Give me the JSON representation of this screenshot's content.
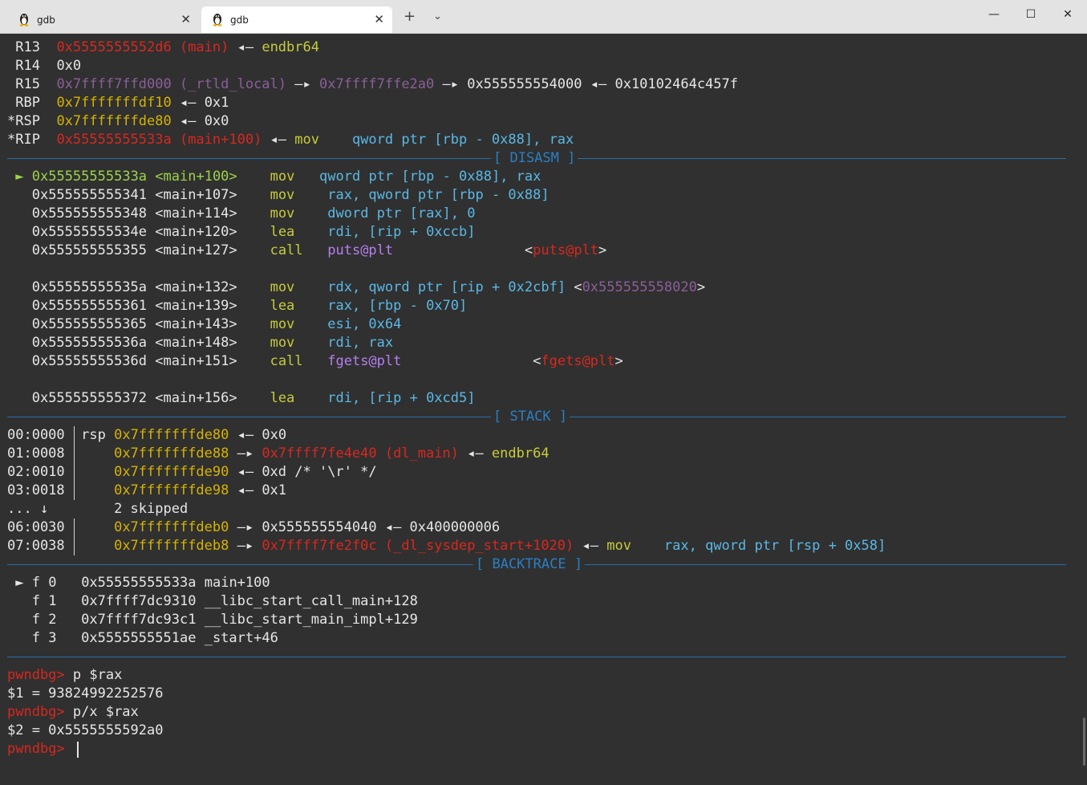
{
  "window": {
    "tabs": [
      {
        "label": "gdb",
        "icon": "linux-penguin-icon",
        "active": false
      },
      {
        "label": "gdb",
        "icon": "linux-penguin-icon",
        "active": true
      }
    ],
    "new_tab": "+",
    "dropdown": "⌄",
    "minimize": "—",
    "maximize": "☐",
    "close": "✕",
    "tab_close": "✕"
  },
  "registers": [
    {
      "name": " R13",
      "val": "0x5555555552d6 (main)",
      "arrow": " ◂— ",
      "target": "endbr64"
    },
    {
      "name": " R14",
      "val": "0x0"
    },
    {
      "name": " R15",
      "val": "0x7ffff7ffd000 (_rtld_local)",
      "arrow1": " —▸ ",
      "val2": "0x7ffff7ffe2a0",
      "arrow2": " —▸ ",
      "val3": "0x555555554000",
      "arrow3": " ◂— ",
      "val4": "0x10102464c457f"
    },
    {
      "name": " RBP",
      "val": "0x7fffffffdf10",
      "arrow": " ◂— ",
      "target": "0x1"
    },
    {
      "name": "*RSP",
      "val": "0x7fffffffde80",
      "arrow": " ◂— ",
      "target": "0x0"
    },
    {
      "name": "*RIP",
      "val": "0x55555555533a (main+100)",
      "arrow": " ◂— ",
      "mnem": "mov",
      "ops": "qword ptr [rbp - 0x88], rax"
    }
  ],
  "sections": {
    "disasm": "[ DISASM ]",
    "stack": "[ STACK ]",
    "backtrace": "[ BACKTRACE ]"
  },
  "disasm": [
    {
      "marker": "►",
      "addr": "0x55555555533a",
      "sym": "<main+100>",
      "mnem": "mov",
      "ops": "qword ptr [rbp - 0x88], rax"
    },
    {
      "marker": " ",
      "addr": "0x555555555341",
      "sym": "<main+107>",
      "mnem": "mov",
      "ops": "rax, qword ptr [rbp - 0x88]"
    },
    {
      "marker": " ",
      "addr": "0x555555555348",
      "sym": "<main+114>",
      "mnem": "mov",
      "ops": "dword ptr [rax], 0"
    },
    {
      "marker": " ",
      "addr": "0x55555555534e",
      "sym": "<main+120>",
      "mnem": "lea",
      "ops": "rdi, [rip + 0xccb]"
    },
    {
      "marker": " ",
      "addr": "0x555555555355",
      "sym": "<main+127>",
      "mnem": "call",
      "ops": "puts@plt",
      "target": "puts@plt"
    },
    {
      "marker": " ",
      "addr": "0x55555555535a",
      "sym": "<main+132>",
      "mnem": "mov",
      "ops": "rdx, qword ptr [rip + 0x2cbf]",
      "target": "0x555555558020"
    },
    {
      "marker": " ",
      "addr": "0x555555555361",
      "sym": "<main+139>",
      "mnem": "lea",
      "ops": "rax, [rbp - 0x70]"
    },
    {
      "marker": " ",
      "addr": "0x555555555365",
      "sym": "<main+143>",
      "mnem": "mov",
      "ops": "esi, 0x64"
    },
    {
      "marker": " ",
      "addr": "0x55555555536a",
      "sym": "<main+148>",
      "mnem": "mov",
      "ops": "rdi, rax"
    },
    {
      "marker": " ",
      "addr": "0x55555555536d",
      "sym": "<main+151>",
      "mnem": "call",
      "ops": "fgets@plt",
      "target": "fgets@plt"
    },
    {
      "marker": " ",
      "addr": "0x555555555372",
      "sym": "<main+156>",
      "mnem": "lea",
      "ops": "rdi, [rip + 0xcd5]"
    }
  ],
  "stack": [
    {
      "off": "00:0000",
      "reg": "rsp",
      "addr": "0x7fffffffde80",
      "rest": " ◂— 0x0"
    },
    {
      "off": "01:0008",
      "reg": "",
      "addr": "0x7fffffffde88",
      "arrow": " —▸ ",
      "val": "0x7ffff7fe4e40 (dl_main)",
      "rest": " ◂— endbr64"
    },
    {
      "off": "02:0010",
      "reg": "",
      "addr": "0x7fffffffde90",
      "rest": " ◂— 0xd /* '\\r' */"
    },
    {
      "off": "03:0018",
      "reg": "",
      "addr": "0x7fffffffde98",
      "rest": " ◂— 0x1"
    },
    {
      "off": "... ↓",
      "skipped": "2 skipped"
    },
    {
      "off": "06:0030",
      "reg": "",
      "addr": "0x7fffffffdeb0",
      "rest": " —▸ 0x555555554040 ◂— 0x400000006"
    },
    {
      "off": "07:0038",
      "reg": "",
      "addr": "0x7fffffffdeb8",
      "arrow": " —▸ ",
      "val": "0x7ffff7fe2f0c (_dl_sysdep_start+1020)",
      "arrow2": " ◂— ",
      "mnem": "mov",
      "ops": "rax, qword ptr [rsp + 0x58]"
    }
  ],
  "backtrace": [
    {
      "marker": "►",
      "frame": "f 0",
      "addr": "0x55555555533a",
      "sym": "main+100"
    },
    {
      "marker": " ",
      "frame": "f 1",
      "addr": "0x7ffff7dc9310",
      "sym": "__libc_start_call_main+128"
    },
    {
      "marker": " ",
      "frame": "f 2",
      "addr": "0x7ffff7dc93c1",
      "sym": "__libc_start_main_impl+129"
    },
    {
      "marker": " ",
      "frame": "f 3",
      "addr": "0x5555555551ae",
      "sym": "_start+46"
    }
  ],
  "console": [
    {
      "prompt": "pwndbg> ",
      "text": "p $rax"
    },
    {
      "prompt": "",
      "text": "$1 = 93824992252576"
    },
    {
      "prompt": "pwndbg> ",
      "text": "p/x $rax"
    },
    {
      "prompt": "",
      "text": "$2 = 0x5555555592a0"
    },
    {
      "prompt": "pwndbg> ",
      "text": ""
    }
  ]
}
